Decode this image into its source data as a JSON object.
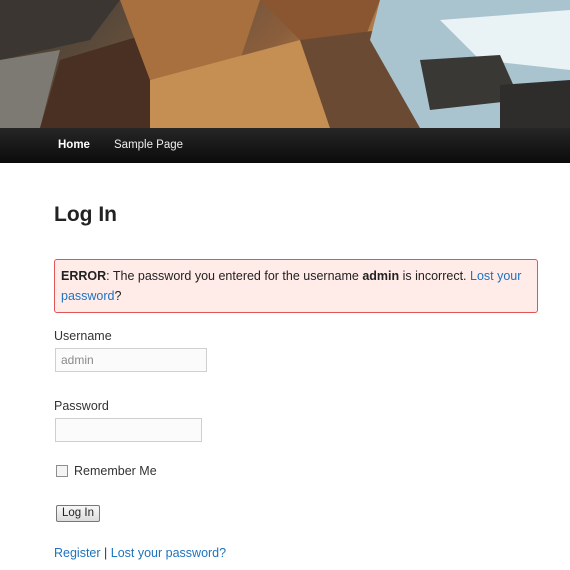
{
  "nav": {
    "items": [
      {
        "label": "Home"
      },
      {
        "label": "Sample Page"
      }
    ]
  },
  "page": {
    "title": "Log In"
  },
  "error": {
    "prefix": "ERROR",
    "text_before_user": ": The password you entered for the username ",
    "username": "admin",
    "text_after_user": " is incorrect. ",
    "link_line1": "Lost your",
    "link_line2": "password",
    "suffix": "?"
  },
  "form": {
    "username_label": "Username",
    "username_value": "admin",
    "password_label": "Password",
    "password_value": "",
    "remember_label": "Remember Me",
    "remember_checked": false,
    "submit_label": "Log In"
  },
  "footer": {
    "register_link": "Register",
    "separator": " | ",
    "lost_password_link": "Lost your password?"
  },
  "colors": {
    "link": "#1e73be",
    "error_border": "#e05555",
    "error_background": "#ffebe8",
    "nav_background": "#111111"
  }
}
